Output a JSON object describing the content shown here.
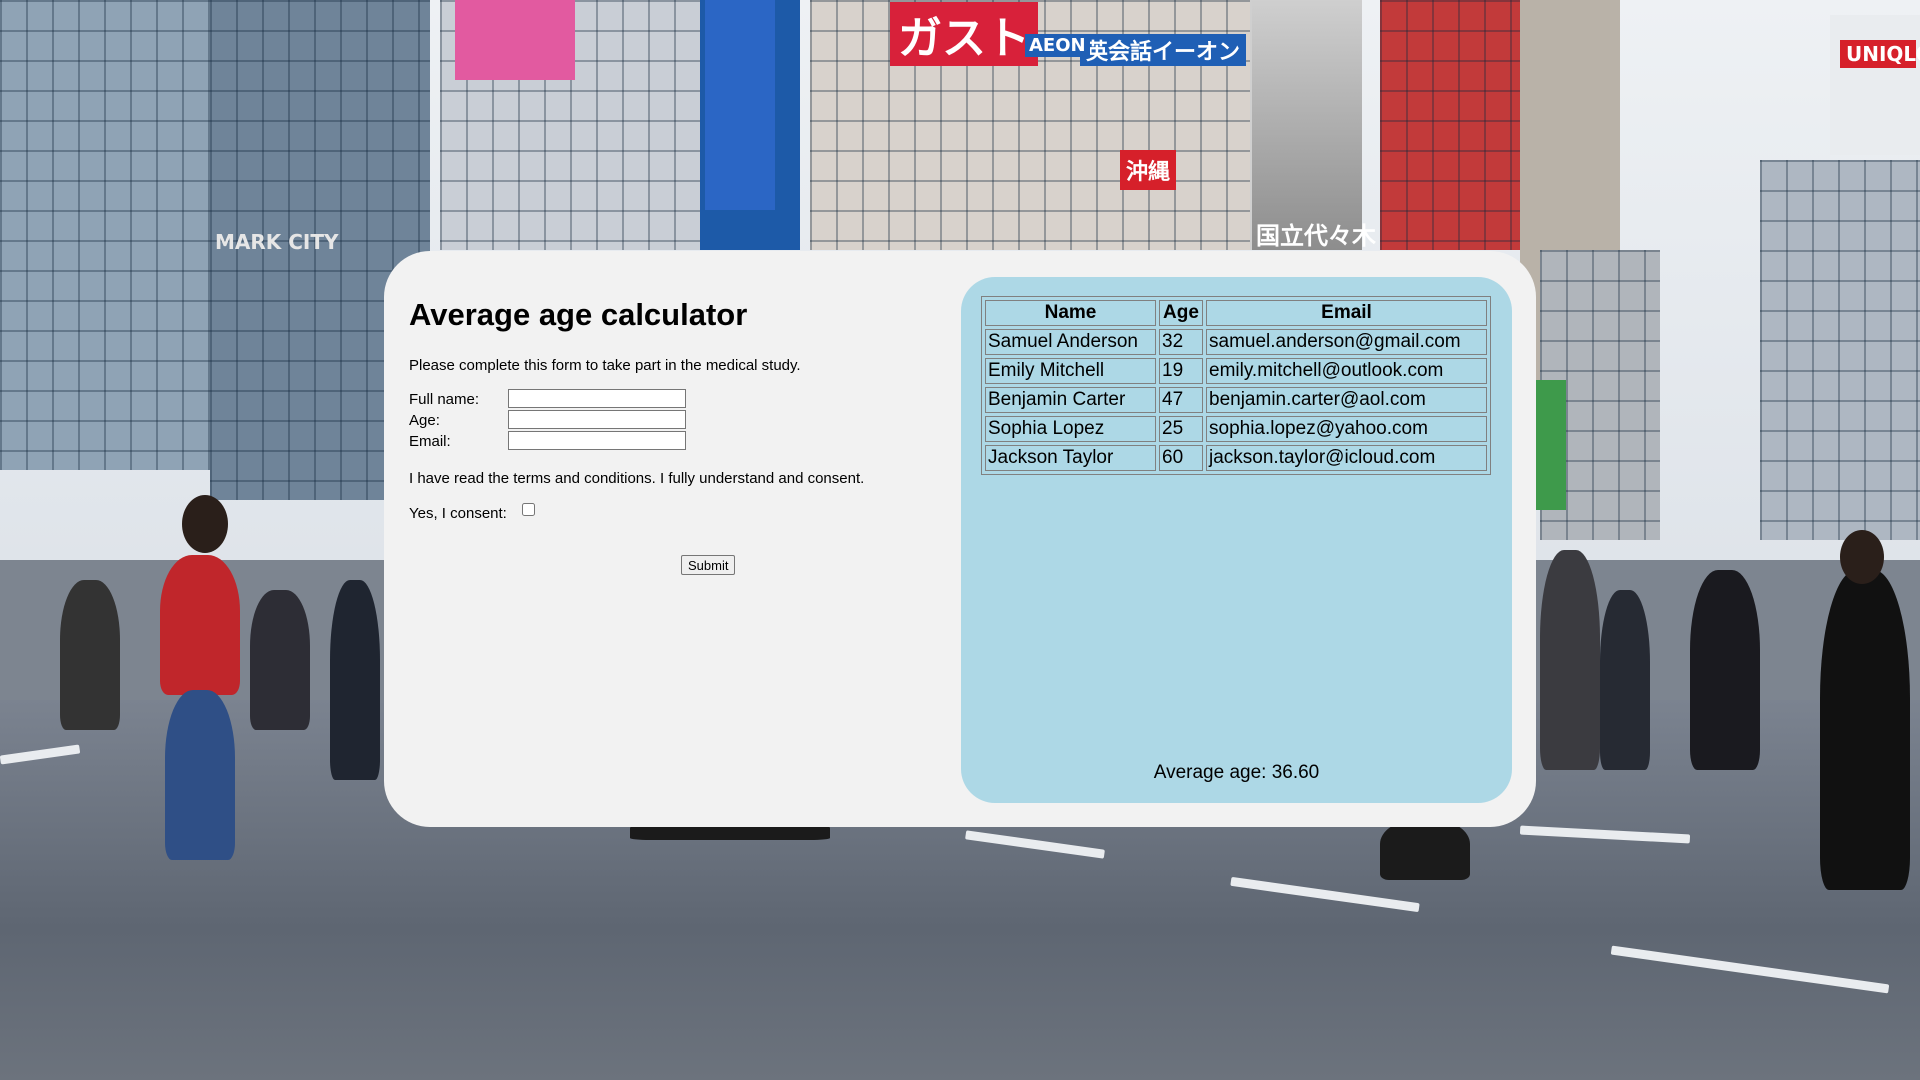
{
  "form": {
    "title": "Average age calculator",
    "intro": "Please complete this form to take part in the medical study.",
    "fields": [
      {
        "label": "Full name:",
        "value": ""
      },
      {
        "label": "Age:",
        "value": ""
      },
      {
        "label": "Email:",
        "value": ""
      }
    ],
    "terms": "I have read the terms and conditions. I fully understand and consent.",
    "consent_label": "Yes, I consent:",
    "submit_label": "Submit"
  },
  "table": {
    "headers": [
      "Name",
      "Age",
      "Email"
    ],
    "rows": [
      [
        "Samuel Anderson",
        "32",
        "samuel.anderson@gmail.com"
      ],
      [
        "Emily Mitchell",
        "19",
        "emily.mitchell@outlook.com"
      ],
      [
        "Benjamin Carter",
        "47",
        "benjamin.carter@aol.com"
      ],
      [
        "Sophia Lopez",
        "25",
        "sophia.lopez@yahoo.com"
      ],
      [
        "Jackson Taylor",
        "60",
        "jackson.taylor@icloud.com"
      ]
    ]
  },
  "summary": {
    "average_text": "Average age: 36.60"
  },
  "background": {
    "signs": [
      "ガスト",
      "英会話イーオン",
      "AEON",
      "UNIQLO",
      "国立代々木",
      "MARK CITY",
      "沖縄"
    ]
  },
  "colors": {
    "panel": "#f2f2f2",
    "results_panel": "#add8e6"
  }
}
